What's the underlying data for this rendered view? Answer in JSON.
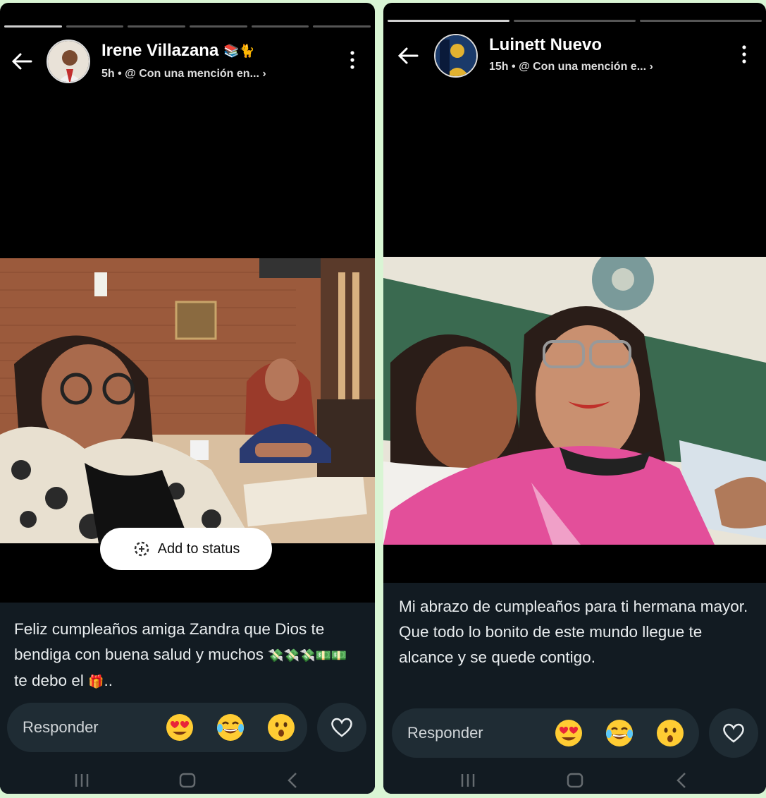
{
  "left_status": {
    "user_name": "Irene Villazana",
    "name_emojis": [
      "📚",
      "🐈"
    ],
    "time": "5h",
    "mention_text": "@ Con una mención en...",
    "add_to_status_label": "Add to status",
    "caption": "Feliz cumpleaños amiga Zandra que Dios te bendiga con buena salud y muchos",
    "caption_emojis": "💸💸💸💵💵",
    "caption_tail": "te debo el",
    "caption_tail_emoji": "🎁",
    "caption_ellipsis": "..",
    "reply_label": "Responder",
    "reactions": [
      "heart-eyes",
      "laughing-tears",
      "surprised"
    ]
  },
  "right_status": {
    "user_name": "Luinett Nuevo",
    "time": "15h",
    "mention_text": "@ Con una mención e...",
    "caption": "Mi abrazo de cumpleaños para ti hermana mayor. Que todo lo bonito de este mundo llegue te alcance y se quede contigo.",
    "reply_label": "Responder",
    "reactions": [
      "heart-eyes",
      "laughing-tears",
      "surprised"
    ]
  },
  "colors": {
    "app_background": "#000000",
    "caption_background": "#121b22",
    "reply_bar": "#1f2c34",
    "frame_green": "#d9f5d4"
  }
}
